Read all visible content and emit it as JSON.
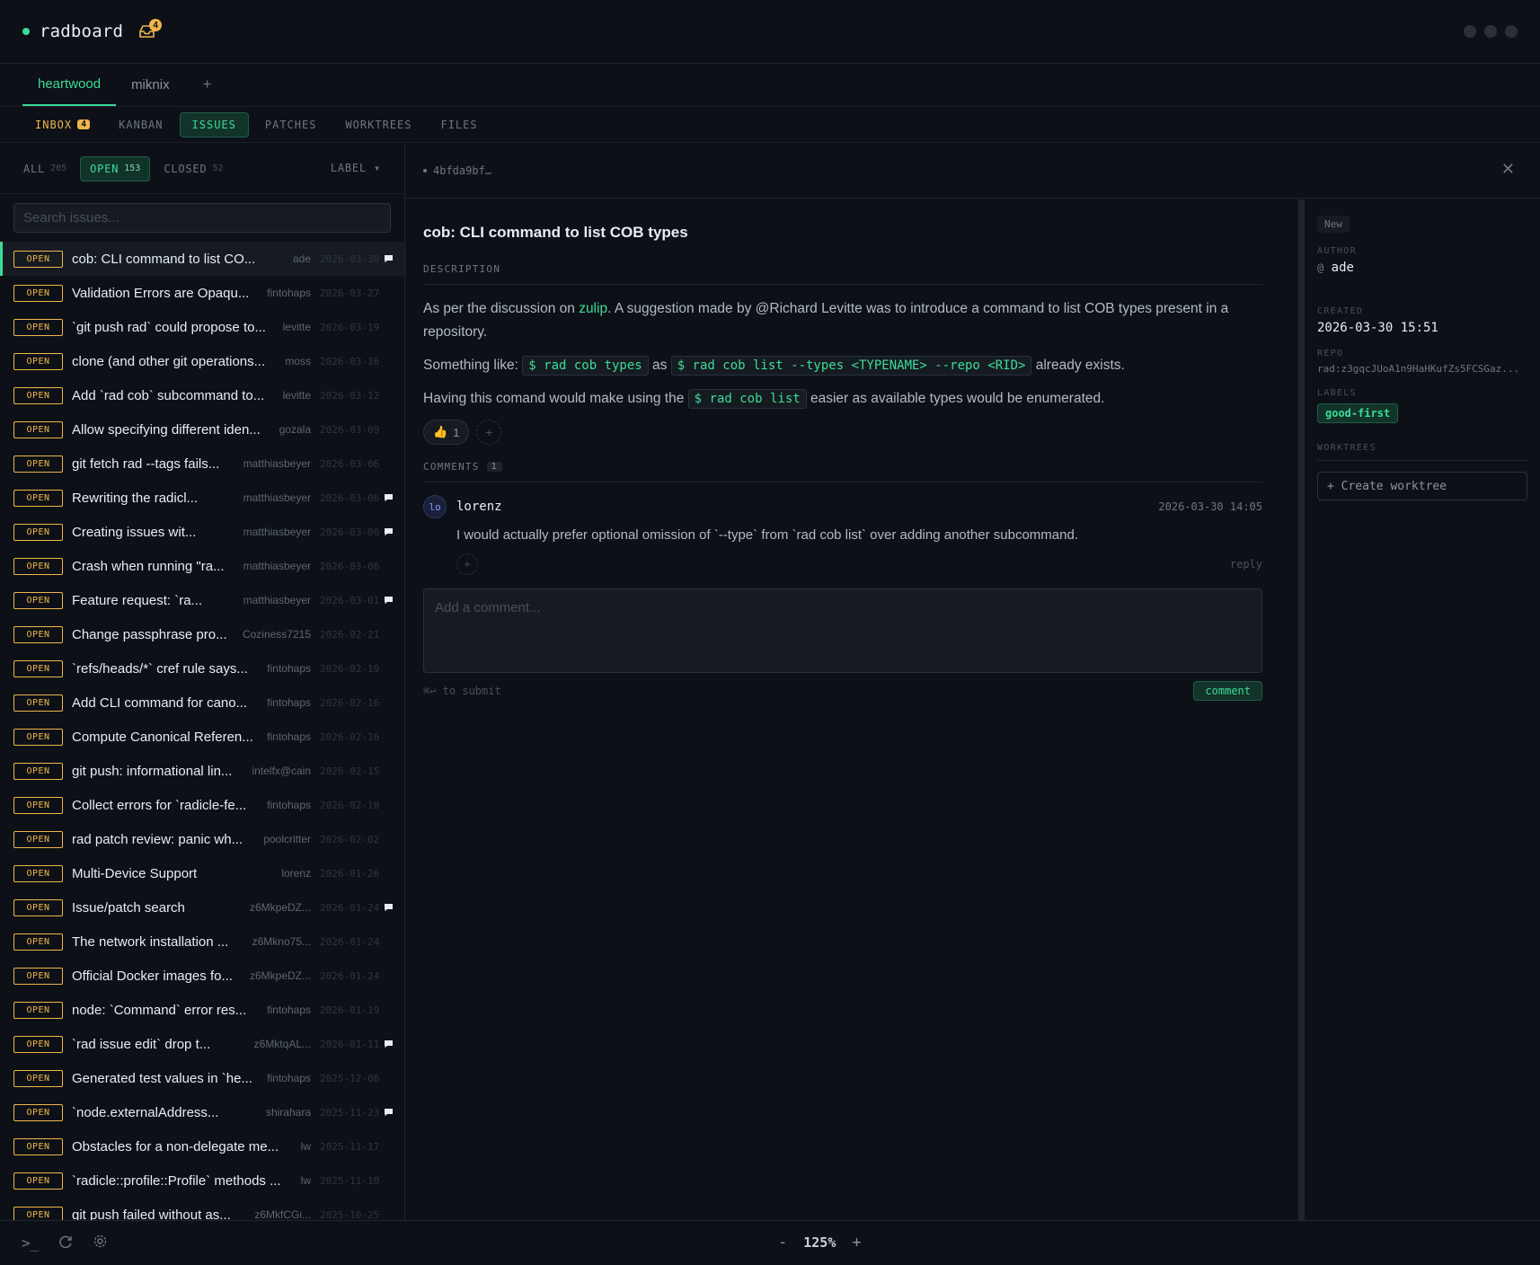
{
  "app": {
    "name": "radboard",
    "inbox_badge": "4"
  },
  "repo_tabs": [
    {
      "label": "heartwood",
      "active": true
    },
    {
      "label": "miknix",
      "active": false
    }
  ],
  "repo_add_label": "+",
  "view_tabs": [
    {
      "label": "INBOX",
      "count": "4"
    },
    {
      "label": "KANBAN"
    },
    {
      "label": "ISSUES"
    },
    {
      "label": "PATCHES"
    },
    {
      "label": "WORKTREES"
    },
    {
      "label": "FILES"
    }
  ],
  "filters": {
    "all": {
      "label": "ALL",
      "count": "205"
    },
    "open": {
      "label": "OPEN",
      "count": "153"
    },
    "closed": {
      "label": "CLOSED",
      "count": "52"
    },
    "label_button": "LABEL ▾"
  },
  "search": {
    "placeholder": "Search issues..."
  },
  "issues": [
    {
      "status": "OPEN",
      "title": "cob: CLI command to list CO...",
      "author": "ade",
      "date": "2026-03-30",
      "comment": true
    },
    {
      "status": "OPEN",
      "title": "Validation Errors are Opaqu...",
      "author": "fintohaps",
      "date": "2026-03-27",
      "comment": false
    },
    {
      "status": "OPEN",
      "title": "`git push rad` could propose to...",
      "author": "levitte",
      "date": "2026-03-19",
      "comment": false
    },
    {
      "status": "OPEN",
      "title": "clone (and other git operations...",
      "author": "moss",
      "date": "2026-03-16",
      "comment": false
    },
    {
      "status": "OPEN",
      "title": "Add `rad cob` subcommand to...",
      "author": "levitte",
      "date": "2026-03-12",
      "comment": false
    },
    {
      "status": "OPEN",
      "title": "Allow specifying different iden...",
      "author": "gozala",
      "date": "2026-03-09",
      "comment": false
    },
    {
      "status": "OPEN",
      "title": "git fetch rad --tags fails...",
      "author": "matthiasbeyer",
      "date": "2026-03-06",
      "comment": false
    },
    {
      "status": "OPEN",
      "title": "Rewriting the radicl...",
      "author": "matthiasbeyer",
      "date": "2026-03-06",
      "comment": true
    },
    {
      "status": "OPEN",
      "title": "Creating issues wit...",
      "author": "matthiasbeyer",
      "date": "2026-03-06",
      "comment": true
    },
    {
      "status": "OPEN",
      "title": "Crash when running \"ra...",
      "author": "matthiasbeyer",
      "date": "2026-03-06",
      "comment": false
    },
    {
      "status": "OPEN",
      "title": "Feature request: `ra...",
      "author": "matthiasbeyer",
      "date": "2026-03-01",
      "comment": true
    },
    {
      "status": "OPEN",
      "title": "Change passphrase pro...",
      "author": "Coziness7215",
      "date": "2026-02-21",
      "comment": false
    },
    {
      "status": "OPEN",
      "title": "`refs/heads/*` cref rule says...",
      "author": "fintohaps",
      "date": "2026-02-19",
      "comment": false
    },
    {
      "status": "OPEN",
      "title": "Add CLI command for cano...",
      "author": "fintohaps",
      "date": "2026-02-16",
      "comment": false
    },
    {
      "status": "OPEN",
      "title": "Compute Canonical Referen...",
      "author": "fintohaps",
      "date": "2026-02-16",
      "comment": false
    },
    {
      "status": "OPEN",
      "title": "git push: informational lin...",
      "author": "intelfx@cain",
      "date": "2026-02-15",
      "comment": false
    },
    {
      "status": "OPEN",
      "title": "Collect errors for `radicle-fe...",
      "author": "fintohaps",
      "date": "2026-02-10",
      "comment": false
    },
    {
      "status": "OPEN",
      "title": "rad patch review: panic wh...",
      "author": "poolcritter",
      "date": "2026-02-02",
      "comment": false
    },
    {
      "status": "OPEN",
      "title": "Multi-Device Support",
      "author": "lorenz",
      "date": "2026-01-26",
      "comment": false
    },
    {
      "status": "OPEN",
      "title": "Issue/patch search",
      "author": "z6MkpeDZ...",
      "date": "2026-01-24",
      "comment": true
    },
    {
      "status": "OPEN",
      "title": "The network installation ...",
      "author": "z6Mkno75...",
      "date": "2026-01-24",
      "comment": false
    },
    {
      "status": "OPEN",
      "title": "Official Docker images fo...",
      "author": "z6MkpeDZ...",
      "date": "2026-01-24",
      "comment": false
    },
    {
      "status": "OPEN",
      "title": "node: `Command` error res...",
      "author": "fintohaps",
      "date": "2026-01-19",
      "comment": false
    },
    {
      "status": "OPEN",
      "title": "`rad issue edit` drop t...",
      "author": "z6MktqAL...",
      "date": "2026-01-11",
      "comment": true
    },
    {
      "status": "OPEN",
      "title": "Generated test values in `he...",
      "author": "fintohaps",
      "date": "2025-12-06",
      "comment": false
    },
    {
      "status": "OPEN",
      "title": "`node.externalAddress...",
      "author": "shirahara",
      "date": "2025-11-23",
      "comment": true
    },
    {
      "status": "OPEN",
      "title": "Obstacles for a non-delegate me...",
      "author": "lw",
      "date": "2025-11-17",
      "comment": false
    },
    {
      "status": "OPEN",
      "title": "`radicle::profile::Profile` methods ...",
      "author": "lw",
      "date": "2025-11-10",
      "comment": false
    },
    {
      "status": "OPEN",
      "title": "git push failed without as...",
      "author": "z6MkfCGi...",
      "date": "2025-10-25",
      "comment": false
    }
  ],
  "detail": {
    "id_short": "4bfda9bf…",
    "title": "cob: CLI command to list COB types",
    "description_label": "DESCRIPTION",
    "p1_before": "As per the discussion on ",
    "p1_link": "zulip",
    "p1_after": ". A suggestion made by @Richard Levitte was to introduce a command to list COB types present in a repository.",
    "p2_before": "Something like: ",
    "p2_code1": "$ rad cob types",
    "p2_mid": " as ",
    "p2_code2": "$ rad cob list --types <TYPENAME> --repo <RID>",
    "p2_after": " already exists.",
    "p3_before": "Having this comand would make using the ",
    "p3_code": "$ rad cob list",
    "p3_after": " easier as available types would be enumerated.",
    "reaction": {
      "emoji": "👍",
      "count": "1"
    },
    "comments_label": "COMMENTS",
    "comments_count": "1",
    "comment": {
      "avatar": "lo",
      "author": "lorenz",
      "date": "2026-03-30 14:05",
      "body": "I would actually prefer optional omission of `--type` from `rad cob list` over adding another subcommand.",
      "reply": "reply"
    },
    "comment_placeholder": "Add a comment...",
    "submit_hint": "⌘↩ to submit",
    "comment_button": "comment"
  },
  "sidebar": {
    "state": "New",
    "author_label": "AUTHOR",
    "author": "ade",
    "author_prefix": "@",
    "created_label": "CREATED",
    "created": "2026-03-30 15:51",
    "repo_label": "REPO",
    "repo": "rad:z3gqcJUoA1n9HaHKufZs5FCSGaz...",
    "labels_label": "LABELS",
    "label": "good-first",
    "worktrees_label": "WORKTREES",
    "create_worktree": "+ Create worktree"
  },
  "bottom": {
    "terminal": ">_",
    "zoom_minus": "-",
    "zoom": "125%",
    "zoom_plus": "+"
  },
  "colors": {
    "accent": "#3ddc97",
    "warning": "#f0b54a",
    "bg": "#0d1117"
  }
}
